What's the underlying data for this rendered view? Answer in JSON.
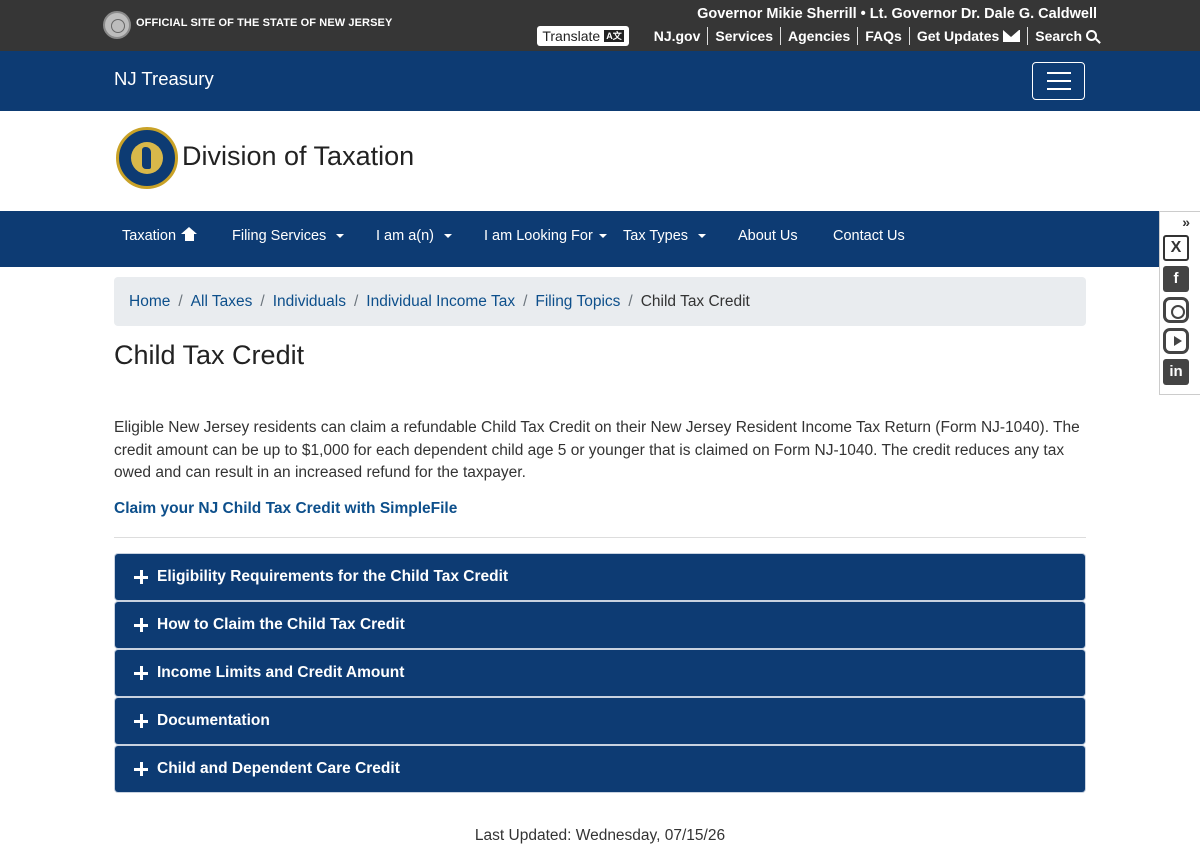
{
  "topbar": {
    "official": "OFFICIAL SITE OF THE STATE OF NEW JERSEY",
    "governor": "Governor Mikie Sherrill • Lt. Governor Dr. Dale G. Caldwell",
    "translate_label": "Translate",
    "translate_icon_text": "A文",
    "links": [
      "NJ.gov",
      "Services",
      "Agencies",
      "FAQs",
      "Get Updates",
      "Search"
    ]
  },
  "treasury": {
    "title": "NJ Treasury"
  },
  "division": {
    "name": "Division of Taxation"
  },
  "nav": {
    "items": [
      "Taxation",
      "Filing Services",
      "I am a(n)",
      "I am Looking For",
      "Tax Types",
      "About Us",
      "Contact Us"
    ]
  },
  "social": {
    "collapse_glyph": "»",
    "icons": [
      "x-icon",
      "facebook-icon",
      "instagram-icon",
      "youtube-icon",
      "linkedin-icon"
    ],
    "x_glyph": "X",
    "facebook_glyph": "f",
    "linkedin_glyph": "in"
  },
  "breadcrumb": {
    "items": [
      "Home",
      "All Taxes",
      "Individuals",
      "Individual Income Tax",
      "Filing Topics"
    ],
    "current": "Child Tax Credit",
    "separator": "/"
  },
  "page": {
    "title": "Child Tax Credit",
    "intro": "Eligible New Jersey residents can claim a refundable Child Tax Credit on their New Jersey Resident Income Tax Return (Form NJ-1040). The credit amount can be up to $1,000 for each dependent child age 5 or younger that is claimed on Form NJ-1040. The credit reduces any tax owed and can result in an increased refund for the taxpayer.",
    "claim_link": "Claim your NJ Child Tax Credit with SimpleFile"
  },
  "accordion": [
    "Eligibility Requirements for the Child Tax Credit",
    "How to Claim the Child Tax Credit",
    "Income Limits and Credit Amount",
    "Documentation",
    "Child and Dependent Care Credit"
  ],
  "footer": {
    "last_updated": "Last Updated: Wednesday, 07/15/26"
  },
  "colors": {
    "navy": "#0d3b73",
    "topbar": "#363636",
    "link": "#0d4f8b"
  }
}
